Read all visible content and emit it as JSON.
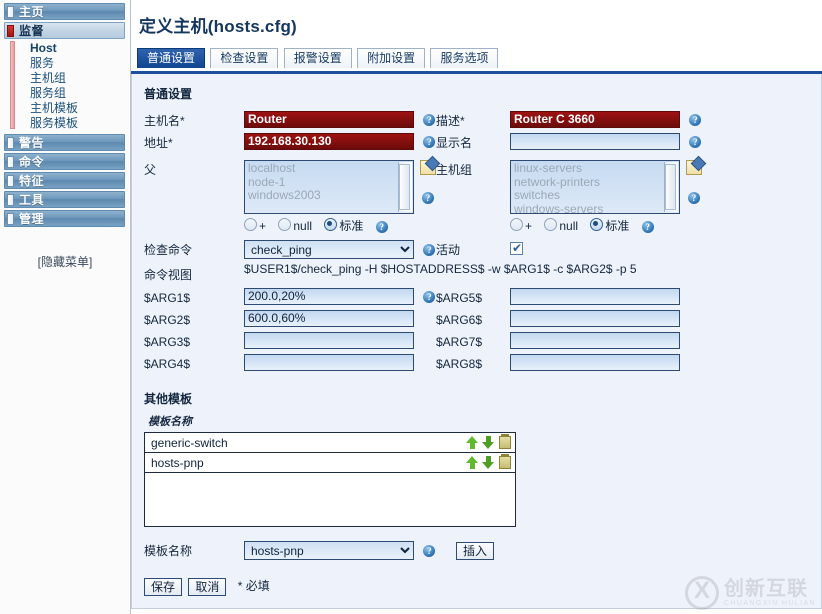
{
  "sidebar": {
    "items": [
      {
        "label": "主页",
        "active": false
      },
      {
        "label": "监督",
        "active": true
      },
      {
        "label": "警告",
        "active": false
      },
      {
        "label": "命令",
        "active": false
      },
      {
        "label": "特征",
        "active": false
      },
      {
        "label": "工具",
        "active": false
      },
      {
        "label": "管理",
        "active": false
      }
    ],
    "submenu": [
      "Host",
      "服务",
      "主机组",
      "服务组",
      "主机模板",
      "服务模板"
    ],
    "hide_menu_label": "[隐藏菜单]"
  },
  "header": {
    "title": "定义主机(hosts.cfg)"
  },
  "tabs": [
    {
      "label": "普通设置",
      "active": true
    },
    {
      "label": "检查设置",
      "active": false
    },
    {
      "label": "报警设置",
      "active": false
    },
    {
      "label": "附加设置",
      "active": false
    },
    {
      "label": "服务选项",
      "active": false
    }
  ],
  "form": {
    "section_title": "普通设置",
    "hostname": {
      "label": "主机名*",
      "value": "Router"
    },
    "address": {
      "label": "地址*",
      "value": "192.168.30.130"
    },
    "description": {
      "label": "描述*",
      "value": "Router C 3660"
    },
    "display_name": {
      "label": "显示名",
      "value": ""
    },
    "parents": {
      "label": "父",
      "options": [
        "localhost",
        "node-1",
        "windows2003"
      ]
    },
    "hostgroups": {
      "label": "主机组",
      "options": [
        "linux-servers",
        "network-printers",
        "switches",
        "windows-servers"
      ]
    },
    "radio_options": [
      {
        "label": "+",
        "selected": false
      },
      {
        "label": "null",
        "selected": false
      },
      {
        "label": "标准",
        "selected": true
      }
    ],
    "check_command": {
      "label": "检查命令",
      "value": "check_ping",
      "options": [
        "check_ping"
      ]
    },
    "active": {
      "label": "活动",
      "checked": true
    },
    "command_view": {
      "label": "命令视图",
      "value": "$USER1$/check_ping -H $HOSTADDRESS$ -w $ARG1$ -c $ARG2$ -p 5"
    },
    "args_left": [
      {
        "label": "$ARG1$",
        "value": "200.0,20%"
      },
      {
        "label": "$ARG2$",
        "value": "600.0,60%"
      },
      {
        "label": "$ARG3$",
        "value": ""
      },
      {
        "label": "$ARG4$",
        "value": ""
      }
    ],
    "args_right": [
      {
        "label": "$ARG5$",
        "value": ""
      },
      {
        "label": "$ARG6$",
        "value": ""
      },
      {
        "label": "$ARG7$",
        "value": ""
      },
      {
        "label": "$ARG8$",
        "value": ""
      }
    ]
  },
  "templates": {
    "section_title": "其他模板",
    "column_header": "模板名称",
    "rows": [
      "generic-switch",
      "hosts-pnp"
    ],
    "select_label": "模板名称",
    "select_value": "hosts-pnp",
    "select_options": [
      "hosts-pnp",
      "generic-switch"
    ],
    "insert_button": "插入"
  },
  "footer": {
    "save_button": "保存",
    "cancel_button": "取消",
    "required_note": "* 必填"
  },
  "watermark": {
    "cn": "创新互联",
    "en": "CHUANGXIN HULIAN"
  },
  "colors": {
    "accent": "#1c4e9c",
    "panel_bg": "#eef3fb",
    "required_field": "#9e1212"
  }
}
